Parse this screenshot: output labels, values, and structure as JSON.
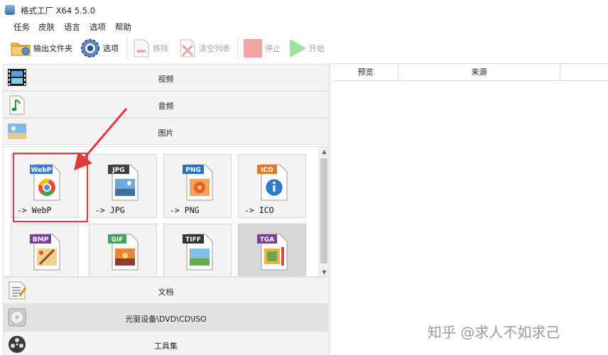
{
  "window": {
    "title": "格式工厂 X64 5.5.0"
  },
  "menu": {
    "items": [
      "任务",
      "皮肤",
      "语言",
      "选项",
      "帮助"
    ]
  },
  "toolbar": {
    "output_folder": "输出文件夹",
    "options": "选项",
    "remove": "移除",
    "clear_list": "清空列表",
    "stop": "停止",
    "start": "开始"
  },
  "categories": {
    "video": "视频",
    "audio": "音频",
    "image": "图片",
    "document": "文档",
    "optical": "光驱设备\\DVD\\CD\\ISO",
    "tools": "工具集"
  },
  "formats": [
    {
      "badge": "WebP",
      "label": "-> WebP",
      "badge_color": "#3f7cc4"
    },
    {
      "badge": "JPG",
      "label": "-> JPG",
      "badge_color": "#404040"
    },
    {
      "badge": "PNG",
      "label": "-> PNG",
      "badge_color": "#2f6fb8"
    },
    {
      "badge": "ICO",
      "label": "-> ICO",
      "badge_color": "#e07a2b"
    },
    {
      "badge": "BMP",
      "label": "",
      "badge_color": "#7d3d9c"
    },
    {
      "badge": "GIF",
      "label": "",
      "badge_color": "#44a35a"
    },
    {
      "badge": "TIFF",
      "label": "",
      "badge_color": "#333333"
    },
    {
      "badge": "TGA",
      "label": "",
      "badge_color": "#7a3f9a"
    }
  ],
  "task_table": {
    "columns": [
      "预览",
      "来源"
    ]
  },
  "watermark": "知乎 @求人不如求己",
  "colors": {
    "highlight": "#e0383b",
    "accent": "#3f7cc4"
  }
}
